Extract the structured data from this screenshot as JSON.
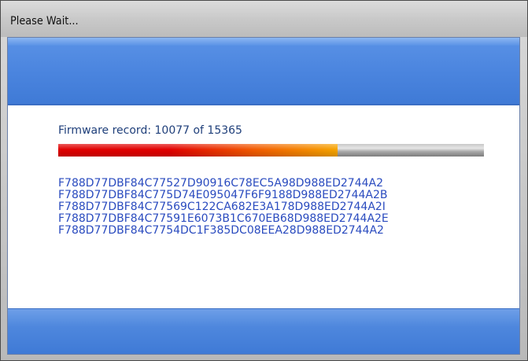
{
  "window": {
    "title": "Please Wait..."
  },
  "status": {
    "text": "Firmware record: 10077 of 15365",
    "current": 10077,
    "total": 15365
  },
  "progress": {
    "fraction": 0.656
  },
  "records": [
    "F788D77DBF84C77527D90916C78EC5A98D988ED2744A2",
    "F788D77DBF84C775D74E095047F6F9188D988ED2744A2B",
    "F788D77DBF84C77569C122CA682E3A178D988ED2744A2I",
    "F788D77DBF84C77591E6073B1C670EB68D988ED2744A2E",
    "F788D77DBF84C7754DC1F385DC08EEA28D988ED2744A2"
  ],
  "colors": {
    "accent_band": "#4a84de",
    "text_blue": "#2a4bbf",
    "progress_start": "#e00000",
    "progress_end": "#f6a400"
  }
}
